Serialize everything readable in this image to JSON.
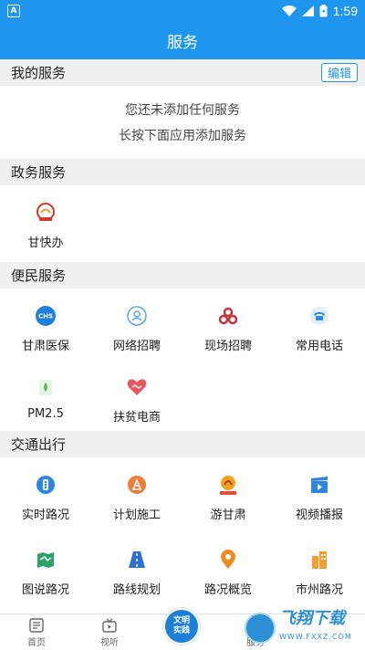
{
  "status_bar": {
    "notification_glyph": "A",
    "time": "1:59"
  },
  "header": {
    "title": "服务"
  },
  "my_services": {
    "title": "我的服务",
    "edit_label": "编辑",
    "empty_line1": "您还未添加任何服务",
    "empty_line2": "长按下面应用添加服务"
  },
  "gov_services": {
    "title": "政务服务",
    "items": [
      {
        "label": "甘快办",
        "icon": "gankuaiban-logo-icon",
        "color": "#d23a2a"
      }
    ]
  },
  "people_services": {
    "title": "便民服务",
    "items": [
      {
        "label": "甘肃医保",
        "icon": "medical-insurance-icon",
        "color": "#1e7fd8"
      },
      {
        "label": "网络招聘",
        "icon": "online-recruitment-icon",
        "color": "#5aa6e8"
      },
      {
        "label": "现场招聘",
        "icon": "onsite-recruitment-icon",
        "color": "#c9333a"
      },
      {
        "label": "常用电话",
        "icon": "phone-icon",
        "color": "#2b8be0"
      },
      {
        "label": "PM2.5",
        "icon": "pm25-icon",
        "color": "#5bb85b"
      },
      {
        "label": "扶贫电商",
        "icon": "handshake-heart-icon",
        "color": "#e9555c"
      }
    ]
  },
  "traffic": {
    "title": "交通出行",
    "items": [
      {
        "label": "实时路况",
        "icon": "traffic-light-icon",
        "color": "#2e86de"
      },
      {
        "label": "计划施工",
        "icon": "construction-icon",
        "color": "#ef7d3c"
      },
      {
        "label": "游甘肃",
        "icon": "travel-gansu-icon",
        "color": "#f3a21e"
      },
      {
        "label": "视频播报",
        "icon": "video-clapper-icon",
        "color": "#2e86de"
      },
      {
        "label": "图说路况",
        "icon": "map-icon",
        "color": "#2aa36b"
      },
      {
        "label": "路线规划",
        "icon": "road-icon",
        "color": "#2e6fd0"
      },
      {
        "label": "路况概览",
        "icon": "location-pin-icon",
        "color": "#f08a24"
      },
      {
        "label": "市州路况",
        "icon": "city-buildings-icon",
        "color": "#f0a030"
      }
    ]
  },
  "bottom_nav": {
    "home": "首页",
    "video": "视听",
    "center_line1": "文明",
    "center_line2": "实践",
    "service": "服务"
  },
  "watermark": {
    "text": "飞翔下载",
    "sub": "WWW.FXXZ.COM"
  },
  "colors": {
    "primary": "#1e96f0",
    "section_bg": "#f0f0f0"
  }
}
